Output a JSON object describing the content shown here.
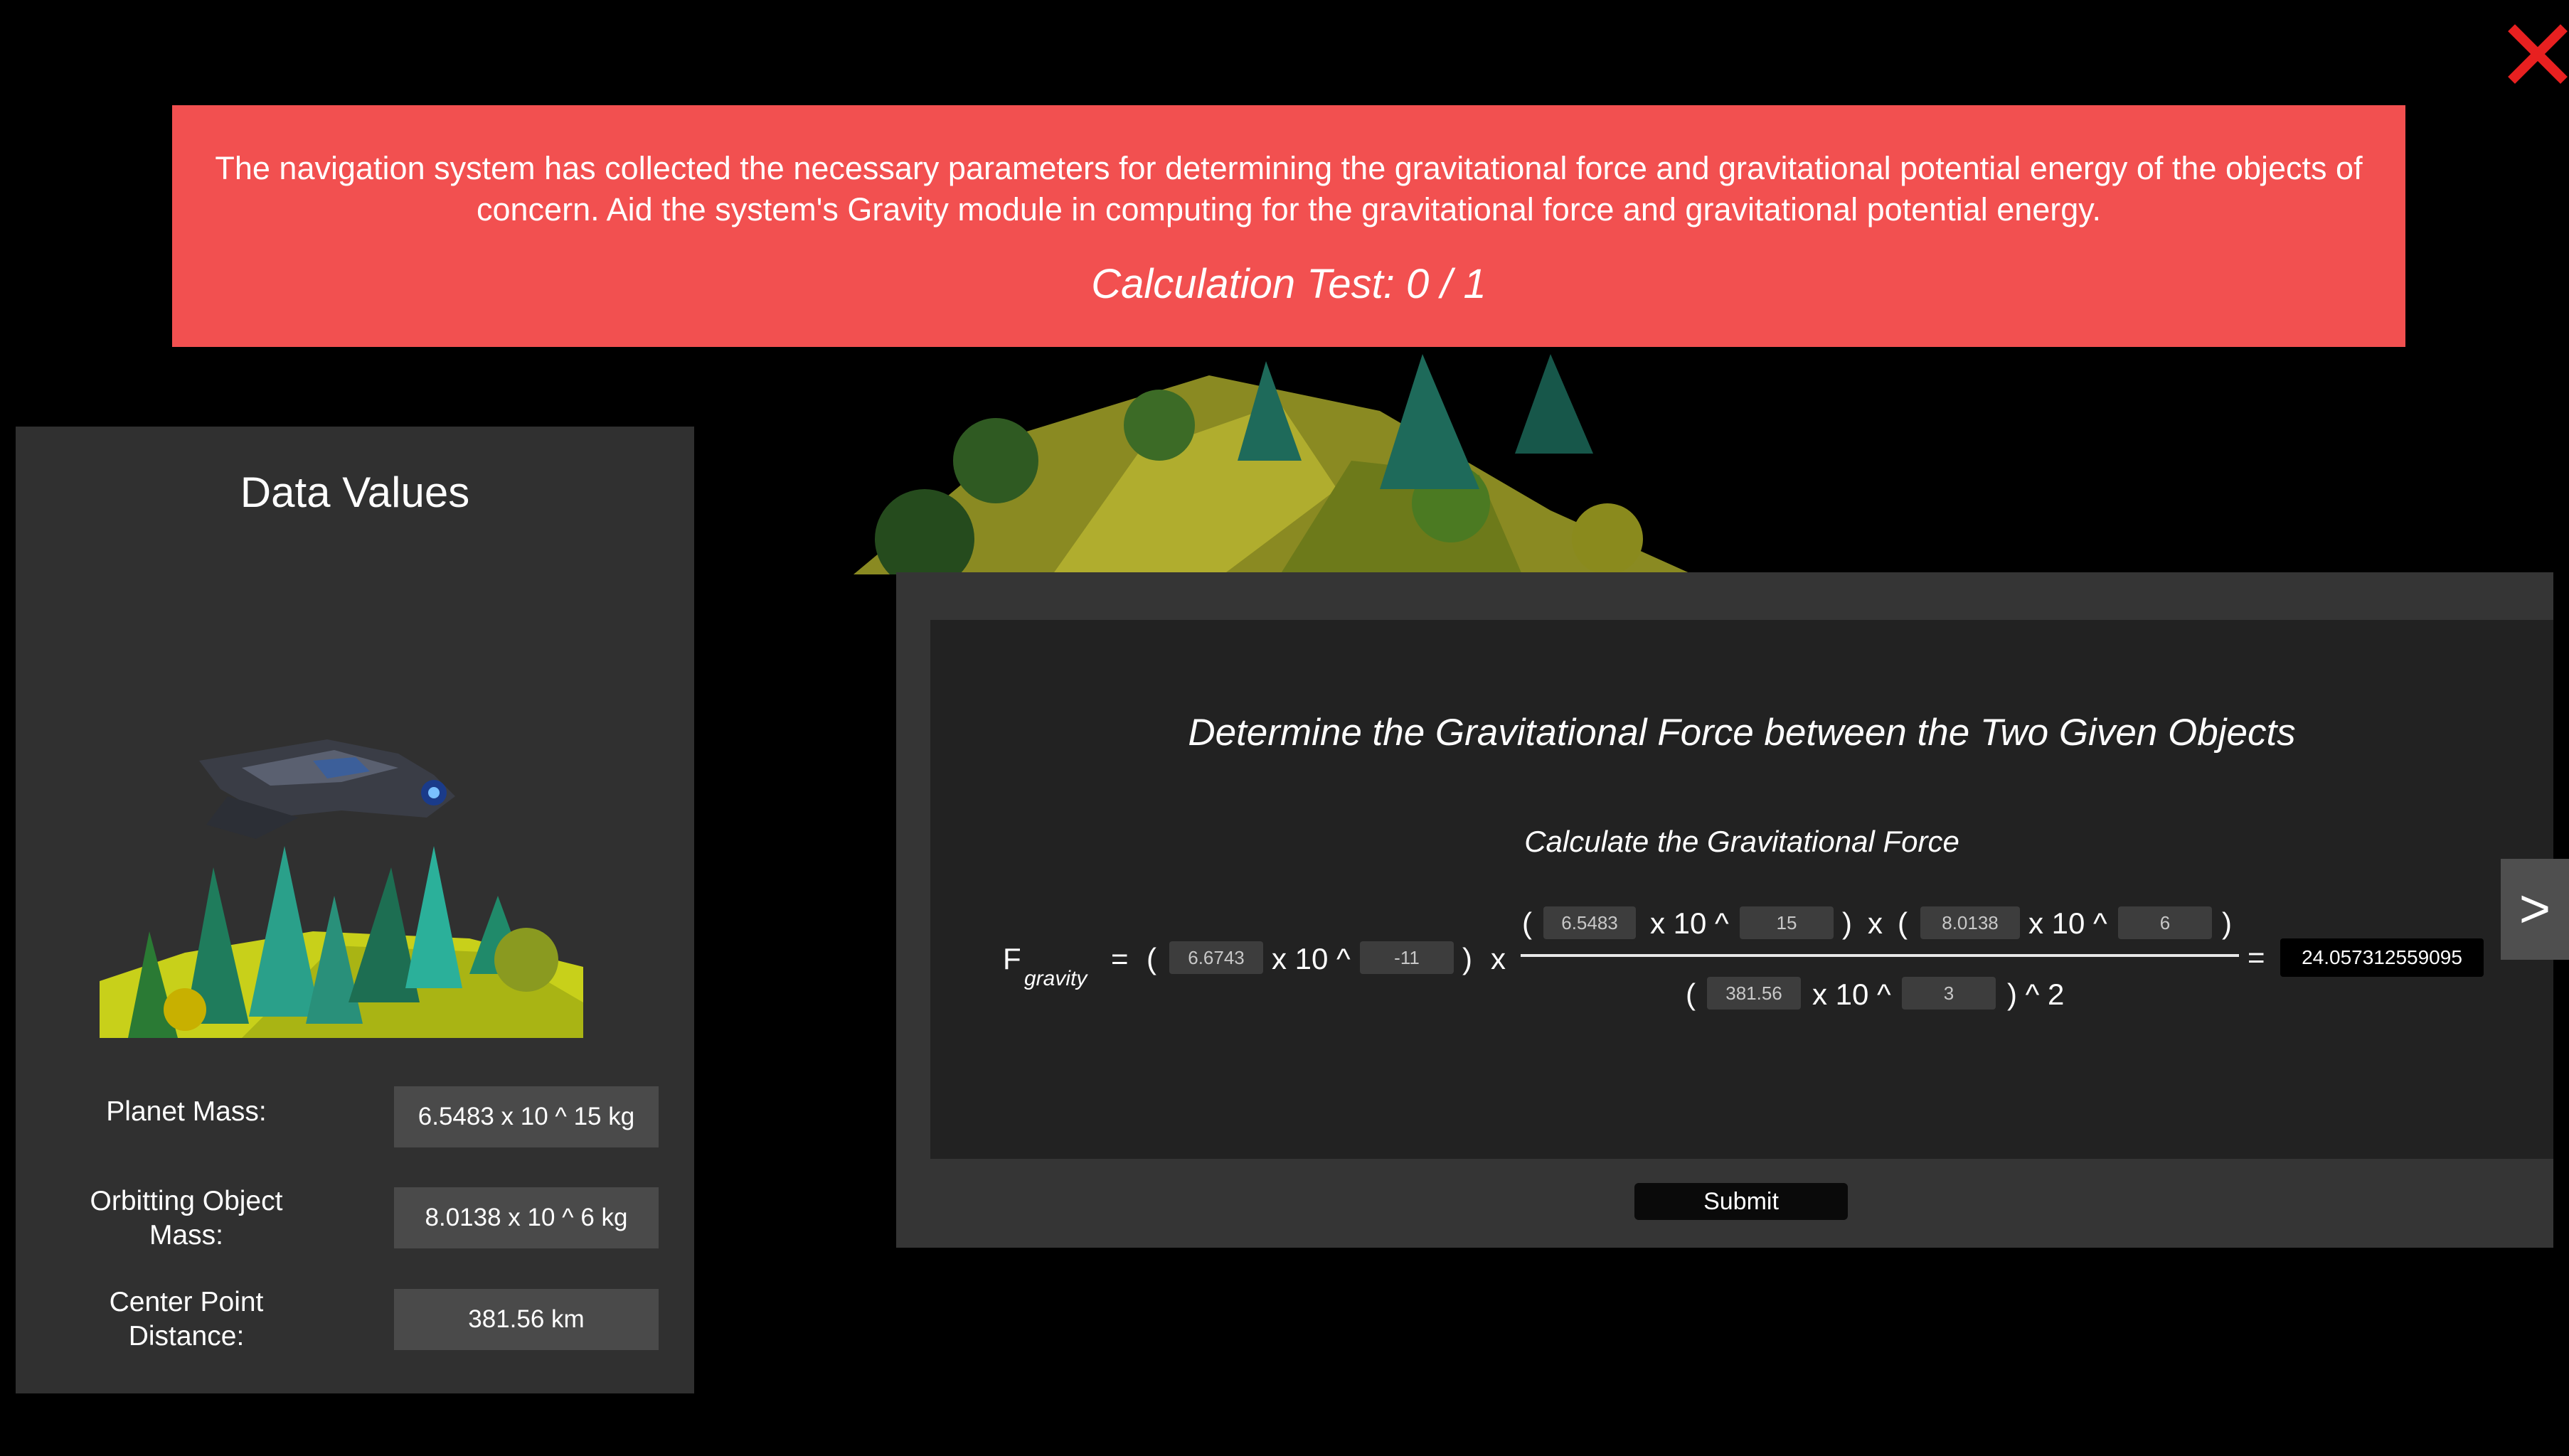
{
  "banner": {
    "message": "The navigation system has collected the necessary parameters for determining the gravitational force and gravitational potential energy of the objects of concern. Aid the system's Gravity module in computing for the gravitational force and gravitational potential energy.",
    "calc_test": "Calculation Test: 0 / 1"
  },
  "close_icon": "close-x-icon",
  "data_panel": {
    "title": "Data Values",
    "planet_mass_label": "Planet Mass:",
    "planet_mass_value": "6.5483 x 10 ^ 15 kg",
    "orbit_mass_label": "Orbitting Object Mass:",
    "orbit_mass_value": "8.0138 x 10 ^ 6 kg",
    "distance_label": "Center Point Distance:",
    "distance_value": "381.56 km"
  },
  "calc": {
    "title": "Determine the Gravitational Force between the Two Given Objects",
    "subtitle": "Calculate the Gravitational Force",
    "f_label": "F",
    "f_subscript": "gravity",
    "eq": "=",
    "open_paren": "(",
    "close_paren": ")",
    "times_ten": "x 10 ^",
    "times": "x",
    "squared": ") ^ 2",
    "g_coeff": "6.6743",
    "g_exp": "-11",
    "m1_coeff": "6.5483",
    "m1_exp": "15",
    "m2_coeff": "8.0138",
    "m2_exp": "6",
    "r_coeff": "381.56",
    "r_exp": "3",
    "result": "24.057312559095",
    "submit_label": "Submit",
    "next_label": ">"
  },
  "colors": {
    "banner": "#f25050",
    "close": "#e82020",
    "panel": "#303030"
  }
}
